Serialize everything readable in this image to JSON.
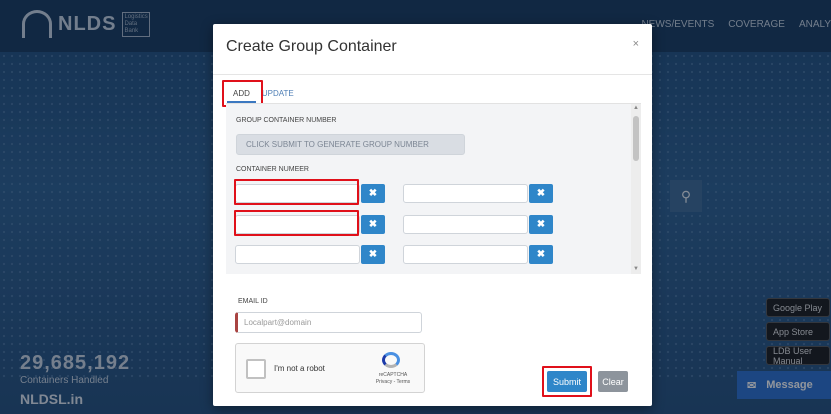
{
  "background": {
    "logo_text": "NLDS",
    "logo_subtext": "Logistics Data Bank",
    "nav_items": [
      "NEWS/EVENTS",
      "COVERAGE",
      "ANALY"
    ],
    "container_count": "29,685,192",
    "container_count_label": "Containers Handled",
    "site_name": "NLDSL.in",
    "store_badges": [
      "Google Play",
      "App Store",
      "LDB User Manual"
    ],
    "message_label": "Message"
  },
  "modal": {
    "title": "Create Group Container",
    "close_glyph": "×",
    "tabs": [
      {
        "label": "ADD",
        "active": true
      },
      {
        "label": "UPDATE",
        "active": false
      }
    ],
    "group_number_label": "GROUP CONTAINER NUMBER",
    "group_number_placeholder": "CLICK SUBMIT TO GENERATE GROUP NUMBER",
    "container_number_label": "CONTAINER NUMEER",
    "container_rows": [
      [
        "",
        ""
      ],
      [
        "",
        ""
      ],
      [
        "",
        ""
      ]
    ],
    "remove_glyph": "✖",
    "email_label": "EMAIL ID",
    "email_placeholder": "Localpart@domain",
    "captcha_text": "I'm not a robot",
    "captcha_brand": "reCAPTCHA",
    "captcha_links": "Privacy - Terms",
    "submit_label": "Submit",
    "clear_label": "Clear"
  },
  "colors": {
    "accent": "#2f86c9",
    "highlight": "#e0101a"
  }
}
